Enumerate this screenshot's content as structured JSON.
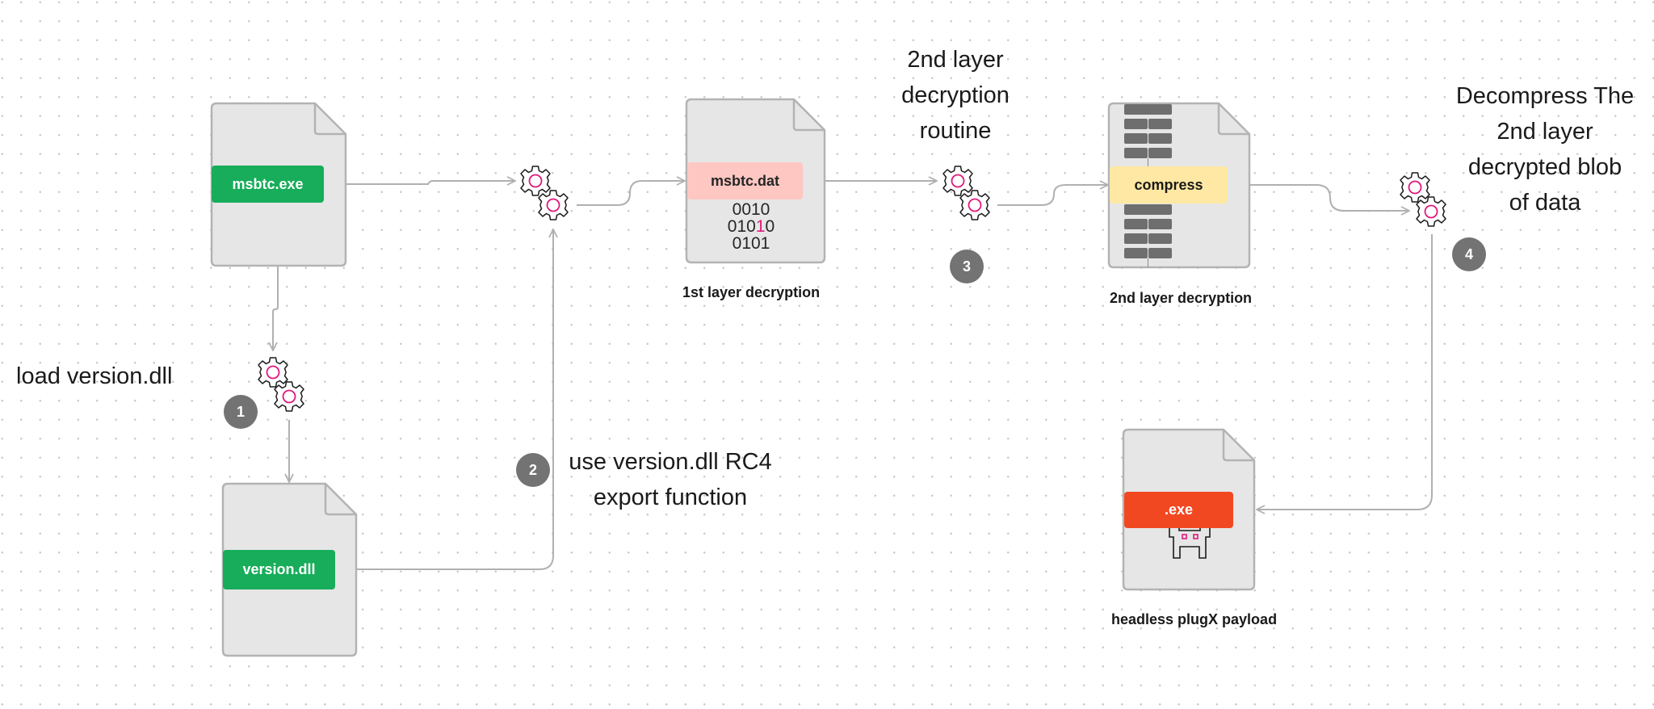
{
  "colors": {
    "doc_fill": "#e6e6e6",
    "doc_stroke": "#b3b3b3",
    "connector": "#b0b0b0",
    "gear_ring": "#e0197d",
    "badge": "#737373",
    "green_label": "#17ad5a",
    "pink_label": "#ffc7c2",
    "yellow_label": "#ffe8a3",
    "red_label": "#f24822",
    "block": "#6e6e6e"
  },
  "nodes": {
    "msbtc_exe": {
      "label": "msbtc.exe"
    },
    "version_dll": {
      "label": "version.dll"
    },
    "msbtc_dat": {
      "label": "msbtc.dat",
      "binary_lines": [
        "0010",
        "01010",
        "0101"
      ],
      "highlight": {
        "line": 1,
        "char_index": 3
      },
      "caption": "1st layer decryption"
    },
    "compress": {
      "label": "compress",
      "caption": "2nd layer decryption"
    },
    "payload": {
      "label": ".exe",
      "icon": "space-invader-icon",
      "caption": "headless plugX payload"
    }
  },
  "annotations": {
    "load": "load version.dll",
    "rc4": [
      "use version.dll RC4",
      "export function"
    ],
    "second_layer": [
      "2nd layer",
      "decryption",
      "routine"
    ],
    "decompress": [
      "Decompress The",
      "2nd layer",
      "decrypted blob",
      "of data"
    ]
  },
  "steps": [
    "1",
    "2",
    "3",
    "4"
  ],
  "icons": {
    "process": "gears-icon"
  }
}
